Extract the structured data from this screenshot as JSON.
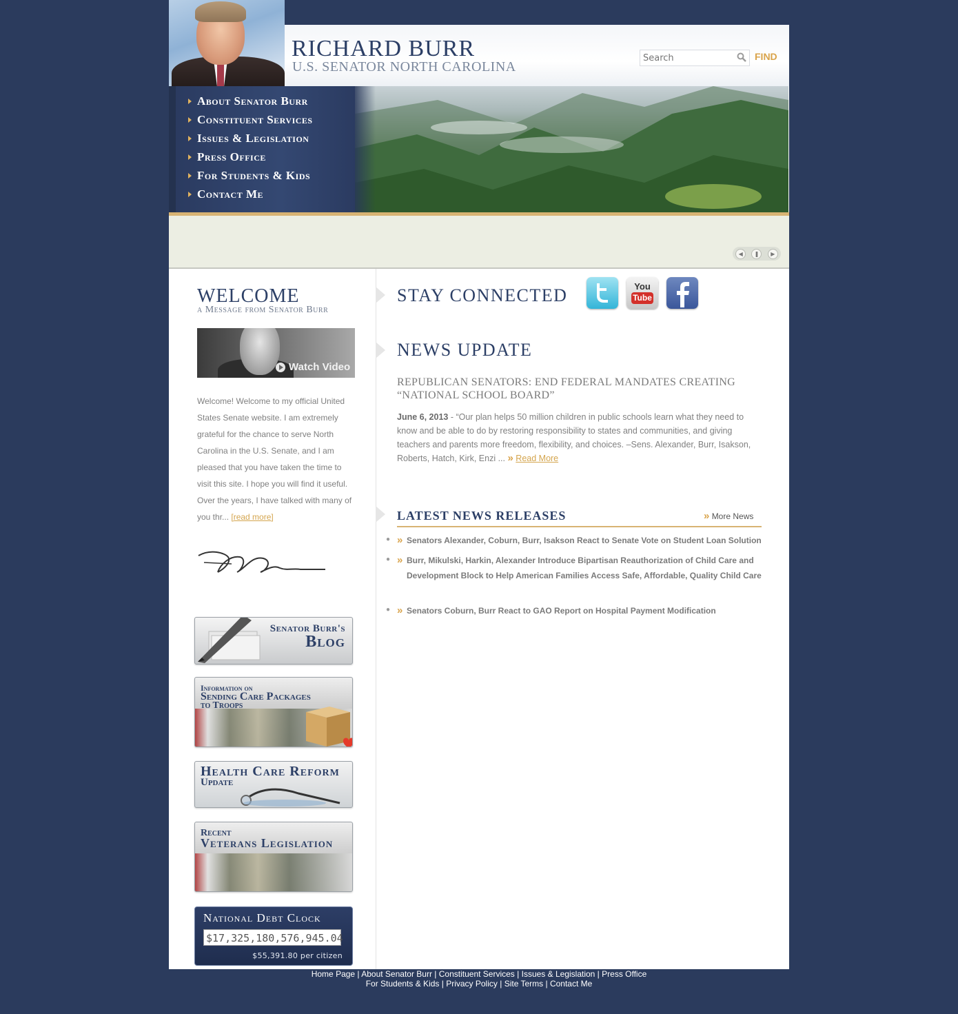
{
  "header": {
    "title": "RICHARD BURR",
    "subtitle": "U.S. SENATOR NORTH CAROLINA",
    "search_placeholder": "Search",
    "find_label": "FIND"
  },
  "nav": {
    "items": [
      {
        "label": "About Senator Burr"
      },
      {
        "label": "Constituent Services"
      },
      {
        "label": "Issues & Legislation"
      },
      {
        "label": "Press Office"
      },
      {
        "label": "For Students & Kids"
      },
      {
        "label": "Contact Me"
      }
    ]
  },
  "slideshow": {
    "controls": [
      "rewind-icon",
      "pause-icon",
      "forward-icon"
    ]
  },
  "welcome": {
    "title": "WELCOME",
    "subtitle": "a Message from Senator Burr",
    "video_label": "Watch Video",
    "text": "Welcome! Welcome to my official United States Senate website. I am extremely grateful for the chance to serve North Carolina in the U.S. Senate, and I am pleased that you have taken the time to visit this site. I hope you will find it useful. Over the years, I have talked with many of you thr... ",
    "read_more": "[read more]"
  },
  "promos": {
    "blog_line1": "Senator Burr's",
    "blog_line2": "Blog",
    "care_line1": "Information on",
    "care_line2": "Sending Care Packages",
    "care_line3": "to Troops",
    "health_line1": "Health Care Reform",
    "health_line2": "Update",
    "veterans_line1": "Recent",
    "veterans_line2": "Veterans Legislation"
  },
  "debt_clock": {
    "title": "National Debt Clock",
    "amount": "$17,325,180,576,945.04",
    "per_citizen": "$55,391.80 per citizen"
  },
  "stay_connected": {
    "title": "STAY CONNECTED",
    "icons": [
      "twitter-icon",
      "youtube-icon",
      "facebook-icon"
    ],
    "youtube_you": "You",
    "youtube_tube": "Tube"
  },
  "news": {
    "title": "NEWS UPDATE",
    "headline": "REPUBLICAN SENATORS: END FEDERAL MANDATES CREATING “NATIONAL SCHOOL BOARD”",
    "date": "June 6, 2013",
    "body": " - “Our plan helps 50 million children in public schools learn what they need to know and be able to do by restoring responsibility to states and communities, and giving teachers and parents more freedom, flexibility, and choices. –Sens. Alexander, Burr, Isakson, Roberts, Hatch, Kirk, Enzi ... ",
    "read_more": "Read More"
  },
  "releases": {
    "title": "LATEST NEWS RELEASES",
    "more_news": "More News",
    "items": [
      {
        "text": "Senators Alexander, Coburn, Burr, Isakson React to Senate Vote on Student Loan Solution"
      },
      {
        "text": "Burr, Mikulski, Harkin, Alexander Introduce Bipartisan Reauthorization of Child Care and Development Block to Help American Families Access Safe, Affordable, Quality Child Care"
      },
      {
        "text": "Senators Coburn, Burr React to GAO Report on Hospital Payment Modification"
      }
    ]
  },
  "footer": {
    "sep": " | ",
    "row1": [
      "Home Page",
      "About Senator Burr",
      "Constituent Services",
      "Issues & Legislation",
      "Press Office"
    ],
    "row2": [
      "For Students & Kids",
      "Privacy Policy",
      "Site Terms",
      "Contact Me"
    ]
  },
  "colors": {
    "background": "#2b3b5d",
    "navy_text": "#2c3f66",
    "gold_accent": "#d9a34a"
  }
}
